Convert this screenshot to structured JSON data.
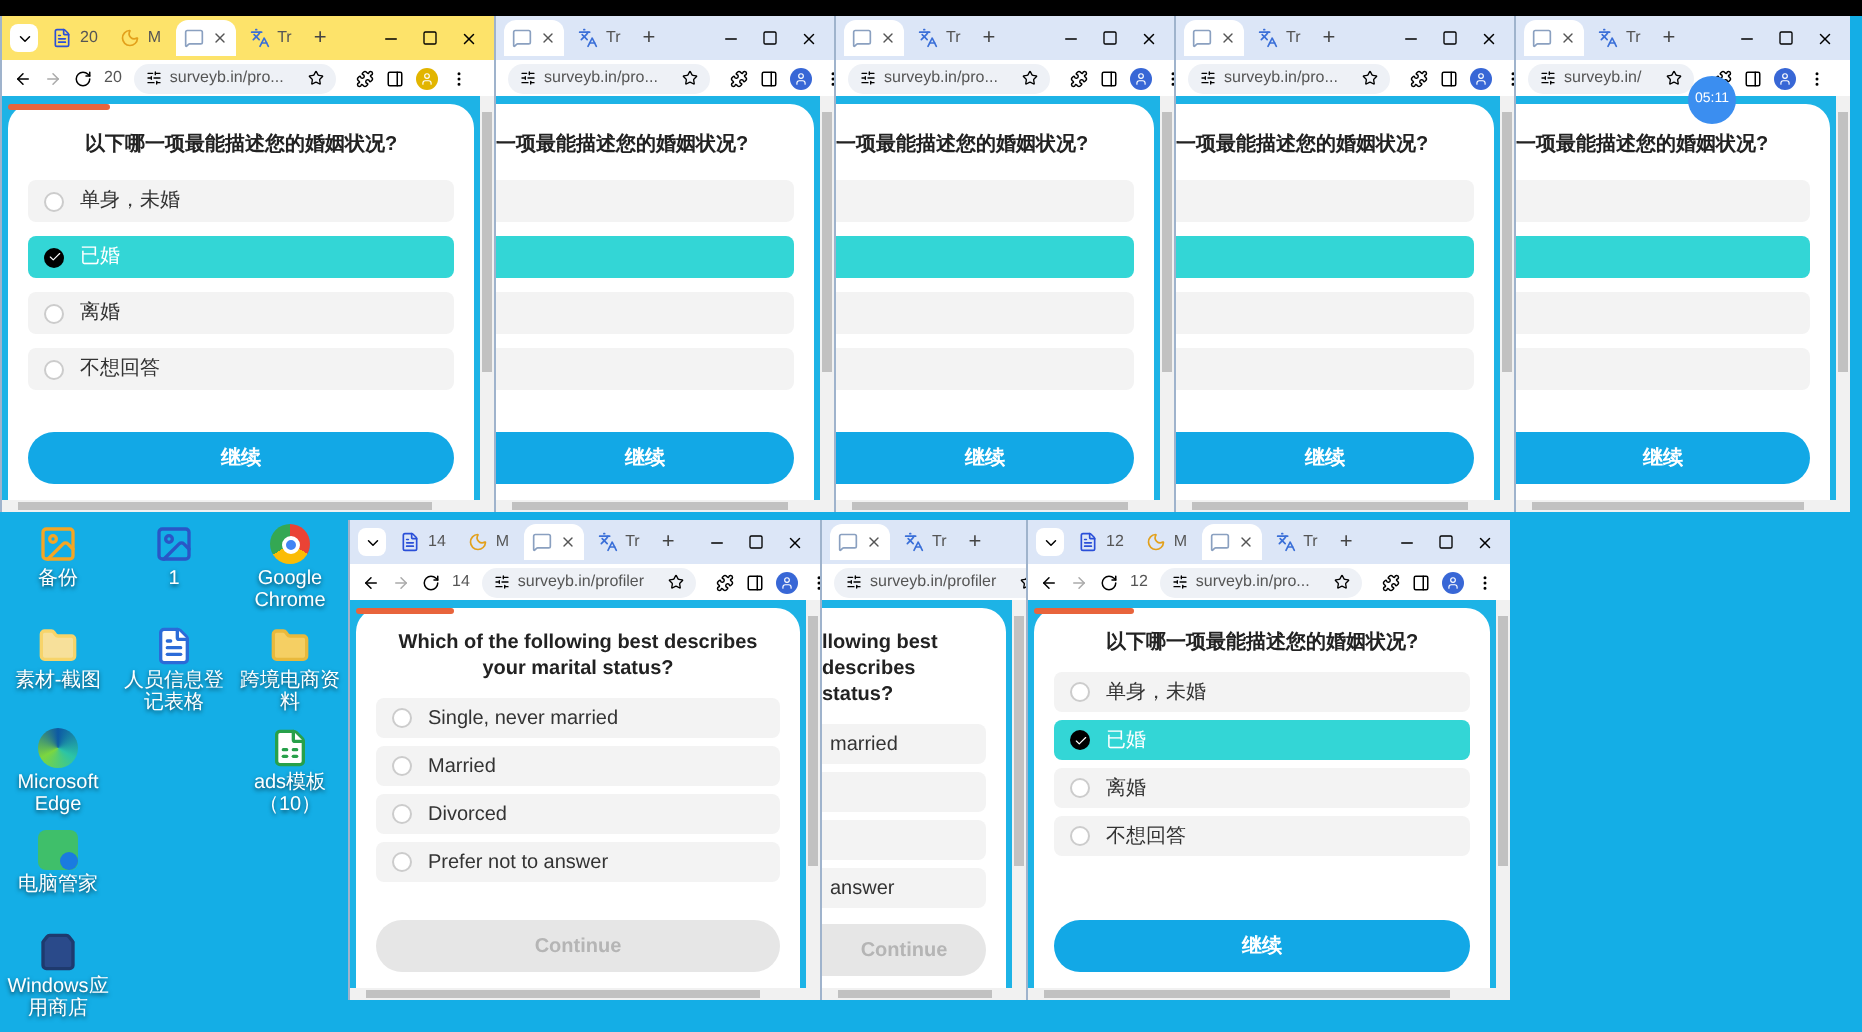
{
  "windows": [
    {
      "kind": "full",
      "focused": true,
      "controls": true,
      "tabs": [
        {
          "kind": "doc",
          "label": "20",
          "selected": false
        },
        {
          "kind": "moon",
          "label": "M",
          "selected": false
        },
        {
          "kind": "chat",
          "selected": true
        },
        {
          "kind": "translate",
          "label": "Tr",
          "selected": false
        }
      ],
      "new_tab": "+",
      "tab_count": "20",
      "url": "surveyb.in/pro...",
      "progress": {
        "level": 0.22
      },
      "question": "以下哪一项最能描述您的婚姻状况?",
      "options": [
        {
          "label": "单身，未婚",
          "selected": false
        },
        {
          "label": "已婚",
          "selected": true
        },
        {
          "label": "离婚",
          "selected": false
        },
        {
          "label": "不想回答",
          "selected": false
        }
      ],
      "button": {
        "label": "继续",
        "disabled": false
      }
    },
    {
      "kind": "partial",
      "focused": false,
      "controls": true,
      "tabs": [
        {
          "kind": "chat",
          "selected": true
        },
        {
          "kind": "translate",
          "label": "Tr",
          "selected": false
        }
      ],
      "new_tab": "+",
      "url": "surveyb.in/pro...",
      "question": "一项最能描述您的婚姻状况?",
      "options": [
        {
          "selected": false
        },
        {
          "selected": true
        },
        {
          "selected": false
        },
        {
          "selected": false
        }
      ],
      "button": {
        "label": "继续",
        "disabled": false
      }
    },
    {
      "kind": "partial",
      "focused": false,
      "controls": true,
      "tabs": [
        {
          "kind": "chat",
          "selected": true
        },
        {
          "kind": "translate",
          "label": "Tr",
          "selected": false
        }
      ],
      "new_tab": "+",
      "url": "surveyb.in/pro...",
      "question": "一项最能描述您的婚姻状况?",
      "options": [
        {
          "selected": false
        },
        {
          "selected": true
        },
        {
          "selected": false
        },
        {
          "selected": false
        }
      ],
      "button": {
        "label": "继续",
        "disabled": false
      }
    },
    {
      "kind": "partial",
      "focused": false,
      "controls": true,
      "tabs": [
        {
          "kind": "chat",
          "selected": true
        },
        {
          "kind": "translate",
          "label": "Tr",
          "selected": false
        }
      ],
      "new_tab": "+",
      "url": "surveyb.in/pro...",
      "question": "一项最能描述您的婚姻状况?",
      "options": [
        {
          "selected": false
        },
        {
          "selected": true
        },
        {
          "selected": false
        },
        {
          "selected": false
        }
      ],
      "button": {
        "label": "继续",
        "disabled": false
      }
    },
    {
      "kind": "partial",
      "focused": false,
      "controls": true,
      "tabs": [
        {
          "kind": "chat",
          "selected": true
        },
        {
          "kind": "translate",
          "label": "Tr",
          "selected": false
        }
      ],
      "new_tab": "+",
      "url": "surveyb.in/",
      "timer": "05:11",
      "question": "一项最能描述您的婚姻状况?",
      "options": [
        {
          "selected": false
        },
        {
          "selected": true
        },
        {
          "selected": false
        },
        {
          "selected": false
        }
      ],
      "button": {
        "label": "继续",
        "disabled": false
      }
    },
    {
      "kind": "full",
      "focused": false,
      "controls": true,
      "tabs": [
        {
          "kind": "doc",
          "label": "14",
          "selected": false
        },
        {
          "kind": "moon",
          "label": "M",
          "selected": false
        },
        {
          "kind": "chat",
          "selected": true
        },
        {
          "kind": "translate",
          "label": "Tr",
          "selected": false
        }
      ],
      "new_tab": "+",
      "tab_count": "14",
      "url": "surveyb.in/profiler",
      "progress": {
        "level": 0.22
      },
      "question": "Which of the following best describes your marital status?",
      "options": [
        {
          "label": "Single, never married",
          "selected": false
        },
        {
          "label": "Married",
          "selected": false
        },
        {
          "label": "Divorced",
          "selected": false
        },
        {
          "label": "Prefer not to answer",
          "selected": false
        }
      ],
      "button": {
        "label": "Continue",
        "disabled": true
      }
    },
    {
      "kind": "partial",
      "focused": false,
      "controls": false,
      "tabs": [
        {
          "kind": "chat",
          "selected": true
        },
        {
          "kind": "translate",
          "label": "Tr",
          "selected": false
        }
      ],
      "new_tab": "+",
      "url": "surveyb.in/profiler",
      "question": "llowing best describes status?",
      "options": [
        {
          "label": "married",
          "selected": false
        },
        {
          "selected": false
        },
        {
          "selected": false
        },
        {
          "label": "answer",
          "selected": false
        }
      ],
      "button": {
        "label": "Continue",
        "disabled": true
      }
    },
    {
      "kind": "full",
      "focused": false,
      "controls": true,
      "tabs": [
        {
          "kind": "doc",
          "label": "12",
          "selected": false
        },
        {
          "kind": "moon",
          "label": "M",
          "selected": false
        },
        {
          "kind": "chat",
          "selected": true
        },
        {
          "kind": "translate",
          "label": "Tr",
          "selected": false
        }
      ],
      "new_tab": "+",
      "tab_count": "12",
      "url": "surveyb.in/pro...",
      "progress": {
        "level": 0.22
      },
      "question": "以下哪一项最能描述您的婚姻状况?",
      "options": [
        {
          "label": "单身，未婚",
          "selected": false
        },
        {
          "label": "已婚",
          "selected": true
        },
        {
          "label": "离婚",
          "selected": false
        },
        {
          "label": "不想回答",
          "selected": false
        }
      ],
      "button": {
        "label": "继续",
        "disabled": false
      }
    }
  ],
  "desktop_columns": [
    [
      {
        "kind": "image",
        "label": "备份"
      },
      {
        "kind": "folder-doc",
        "label": "素材-截图"
      },
      {
        "kind": "edge",
        "label": "Microsoft Edge"
      },
      {
        "kind": "manager",
        "label": "电脑管家"
      },
      {
        "kind": "store",
        "label": "Windows应用商店"
      }
    ],
    [
      {
        "kind": "picture",
        "label": "1"
      },
      {
        "kind": "word",
        "label": "人员信息登记表格"
      }
    ],
    [
      {
        "kind": "chrome",
        "label": "Google Chrome"
      },
      {
        "kind": "folder",
        "label": "跨境电商资料"
      },
      {
        "kind": "sheet",
        "label": "ads模板（10）"
      }
    ]
  ]
}
